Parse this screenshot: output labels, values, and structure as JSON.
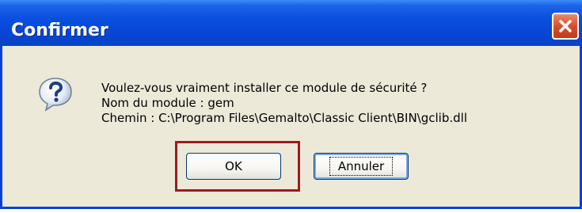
{
  "window": {
    "title": "Confirmer",
    "close_icon": "close-icon"
  },
  "dialog": {
    "icon": "question-icon",
    "lines": [
      "Voulez-vous vraiment installer ce module de sécurité ?",
      "Nom du module : gem",
      "Chemin : C:\\Program Files\\Gemalto\\Classic Client\\BIN\\gclib.dll"
    ]
  },
  "buttons": {
    "ok_label": "OK",
    "cancel_label": "Annuler"
  },
  "colors": {
    "titlebar": "#0a4fde",
    "frame": "#0a3fd6",
    "highlight": "#9b1c1c",
    "background": "#ece9d8"
  }
}
